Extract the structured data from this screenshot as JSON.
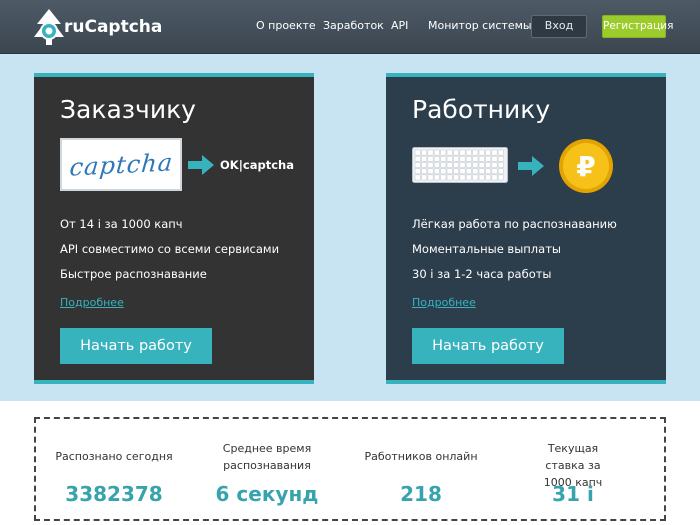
{
  "header": {
    "logo_text": "ruCaptcha",
    "nav": [
      "О проекте",
      "Заработок",
      "API",
      "Монитор системы"
    ],
    "login_label": "Вход",
    "register_label": "Регистрация"
  },
  "customer": {
    "title": "Заказчику",
    "captcha_word": "captcha",
    "result_text": "OK|captcha",
    "features": [
      "От 14 і за 1000 капч",
      "API совместимо со всеми сервисами",
      "Быстрое распознавание"
    ],
    "more_link": "Подробнее",
    "start_button": "Начать работу"
  },
  "worker": {
    "title": "Работнику",
    "coin_symbol": "₽",
    "features": [
      "Лёгкая работа по распознаванию",
      "Моментальные выплаты",
      "30 і за 1-2 часа работы"
    ],
    "more_link": "Подробнее",
    "start_button": "Начать работу"
  },
  "stats": [
    {
      "label": "Распознано сегодня",
      "value": "3382378"
    },
    {
      "label": "Среднее время распознавания",
      "value": "6 секунд"
    },
    {
      "label": "Работников онлайн",
      "value": "218"
    },
    {
      "label": "Текущая ставка за 1000 капч",
      "value": "31 і"
    }
  ],
  "colors": {
    "accent": "#37b3be",
    "register": "#9ccc2c",
    "coin": "#f2b705"
  }
}
